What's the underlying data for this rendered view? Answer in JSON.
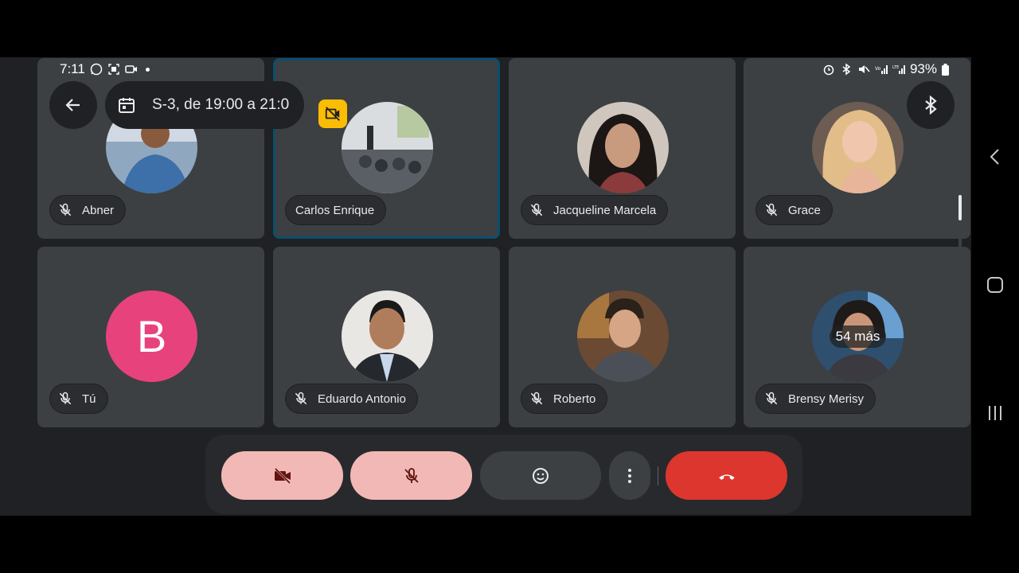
{
  "status_bar": {
    "time": "7:11",
    "battery": "93%"
  },
  "meeting": {
    "title": "S-3, de 19:00 a 21:0"
  },
  "participants": [
    {
      "name": "Abner",
      "muted": true
    },
    {
      "name": "Carlos Enrique",
      "muted": false,
      "video_off_badge": true
    },
    {
      "name": "Jacqueline Marcela",
      "muted": true
    },
    {
      "name": "Grace",
      "muted": true
    },
    {
      "name": "Tú",
      "muted": true,
      "initial": "B"
    },
    {
      "name": "Eduardo Antonio",
      "muted": true
    },
    {
      "name": "Roberto",
      "muted": true
    },
    {
      "name": "Brensy Merisy",
      "muted": true,
      "more_count": "54 más"
    }
  ],
  "controls": {
    "camera": "camera-off-icon",
    "mic": "mic-off-icon",
    "reactions": "smiley-icon",
    "more": "more-vert-icon",
    "hangup": "hangup-icon"
  },
  "colors": {
    "tile_bg": "#3c4043",
    "active_border": "#0b4f6c",
    "muted_control_bg": "#f2b8b5",
    "hangup_bg": "#dc362e",
    "self_avatar_bg": "#e8427c",
    "no_video_badge": "#fbbc04"
  }
}
